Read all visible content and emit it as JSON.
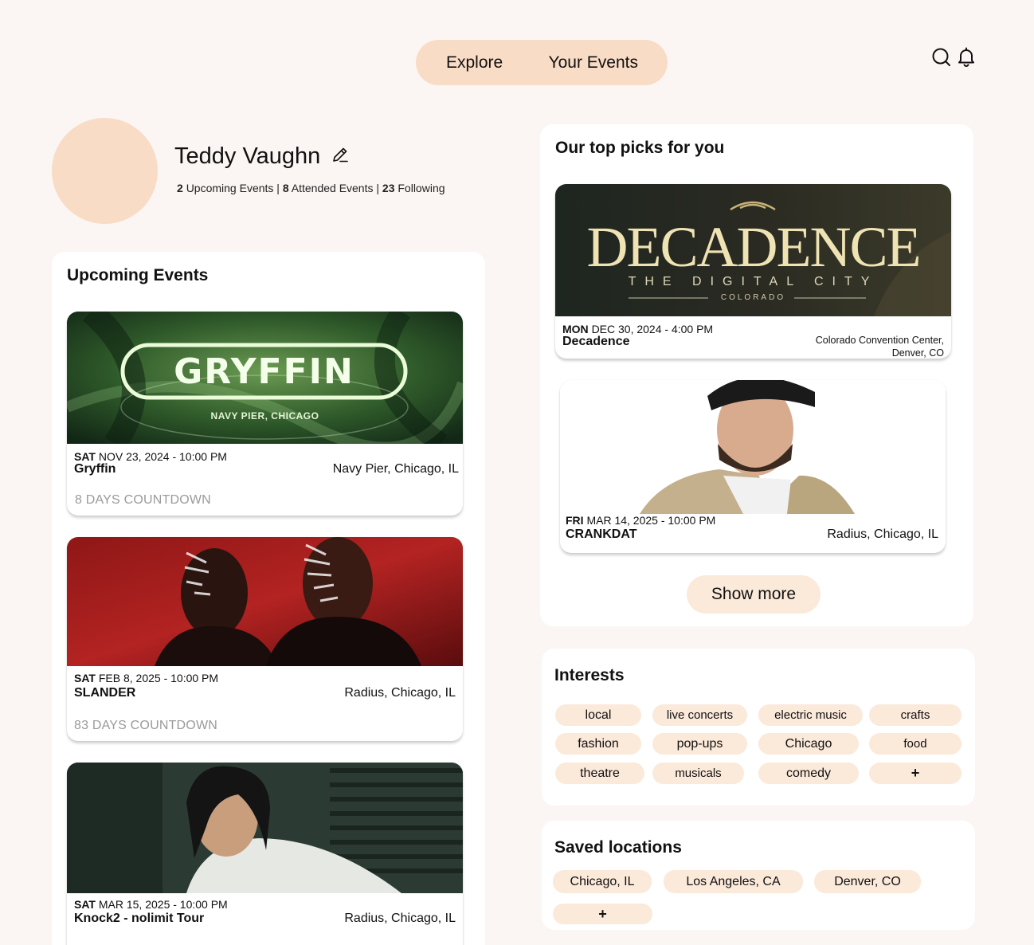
{
  "nav": {
    "tabs": [
      {
        "label": "Explore"
      },
      {
        "label": "Your Events"
      }
    ],
    "icons": [
      "search-icon",
      "bell-icon"
    ]
  },
  "profile": {
    "name": "Teddy Vaughn",
    "upcoming_count": "2",
    "upcoming_label": "Upcoming Events |",
    "attended_count": "8",
    "attended_label": "Attended Events |",
    "following_count": "23",
    "following_label": "Following"
  },
  "upcoming": {
    "title": "Upcoming Events",
    "events": [
      {
        "poster_title": "GRYFFIN",
        "poster_subtitle": "NAVY PIER, CHICAGO",
        "day": "SAT",
        "date": "NOV 23, 2024 - 10:00 PM",
        "name": "Gryffin",
        "venue": "Navy Pier, Chicago, IL",
        "countdown": "8 DAYS COUNTDOWN"
      },
      {
        "day": "SAT",
        "date": "FEB 8, 2025 - 10:00 PM",
        "name": "SLANDER",
        "venue": "Radius, Chicago, IL",
        "countdown": "83 DAYS COUNTDOWN"
      },
      {
        "day": "SAT",
        "date": "MAR 15, 2025 - 10:00 PM",
        "name": "Knock2 - nolimit Tour",
        "venue": "Radius, Chicago, IL"
      }
    ]
  },
  "picks": {
    "title": "Our top picks for you",
    "events": [
      {
        "poster_title": "DECADENCE",
        "poster_subtitle": "THE DIGITAL CITY",
        "poster_tag": "COLORADO",
        "day": "MON",
        "date": "DEC 30, 2024 - 4:00 PM",
        "name": "Decadence",
        "venue_line1": "Colorado Convention Center,",
        "venue_line2": "Denver, CO"
      },
      {
        "day": "FRI",
        "date": "MAR 14, 2025 - 10:00 PM",
        "name": "CRANKDAT",
        "venue": "Radius, Chicago, IL"
      }
    ],
    "show_more": "Show more"
  },
  "interests": {
    "title": "Interests",
    "chips": [
      "local",
      "live concerts",
      "electric music",
      "crafts",
      "fashion",
      "pop-ups",
      "Chicago",
      "food",
      "theatre",
      "musicals",
      "comedy",
      "+"
    ]
  },
  "locations": {
    "title": "Saved locations",
    "chips": [
      "Chicago, IL",
      "Los Angeles, CA",
      "Denver, CO",
      "+"
    ]
  },
  "colors": {
    "background": "#fbf6f3",
    "accent": "#f9dcc6",
    "chip": "#fbe9da",
    "panel": "#ffffff",
    "muted_text": "#9a9a9a"
  }
}
